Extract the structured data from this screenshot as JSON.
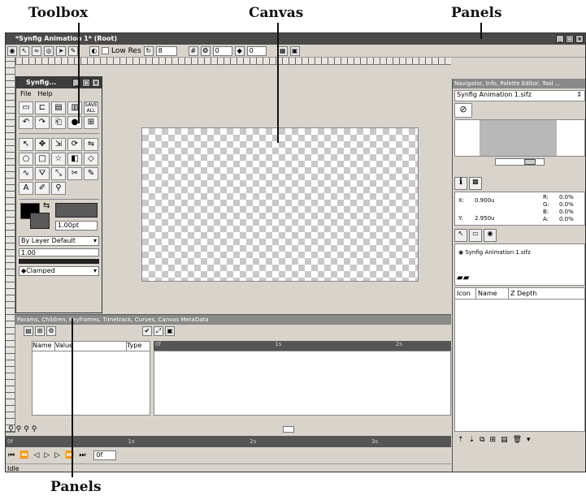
{
  "annotations": {
    "toolbox": "Toolbox",
    "canvas": "Canvas",
    "panels_top": "Panels",
    "panels_bottom": "Panels"
  },
  "window": {
    "title": "*Synfig Animation 1* (Root)"
  },
  "toolbar": {
    "low_res_label": "Low Res",
    "resolution_value": "8",
    "frame_start": "0",
    "frame_end": "0"
  },
  "toolbox": {
    "title": "Synfig...",
    "menu_file": "File",
    "menu_help": "Help",
    "save_all": "SAVE ALL",
    "width_value": "1.00pt",
    "blend_method": "By Layer Default",
    "opacity_value": "1.00",
    "interpolation": "Clamped"
  },
  "params_panel": {
    "title": "Params, Children, Keyframes, Timetrack, Curves, Canvas MetaData",
    "col_name": "Name",
    "col_value": "Value",
    "col_type": "Type",
    "tt_marks": [
      "0f",
      "1s",
      "2s"
    ]
  },
  "timebar": {
    "marks": [
      "0f",
      "1s",
      "2s",
      "3s"
    ],
    "start": "0f"
  },
  "status": {
    "text": "Idle"
  },
  "right_panel": {
    "nav_title": "Navigator, Info, Palette Editor, Tool ...",
    "nav_file": "Synfig Animation 1.sifz",
    "info": {
      "x_label": "X:",
      "x_value": "0.900u",
      "y_label": "Y:",
      "y_value": "2.950u",
      "r_label": "R:",
      "r_value": "0.0%",
      "g_label": "G:",
      "g_value": "0.0%",
      "b_label": "B:",
      "b_value": "0.0%",
      "a_label": "A:",
      "a_value": "0.0%"
    },
    "canvas_browser_item": "Synfig Animation 1.sifz",
    "layers_cols": [
      "Icon",
      "Name",
      "Z Depth"
    ]
  }
}
